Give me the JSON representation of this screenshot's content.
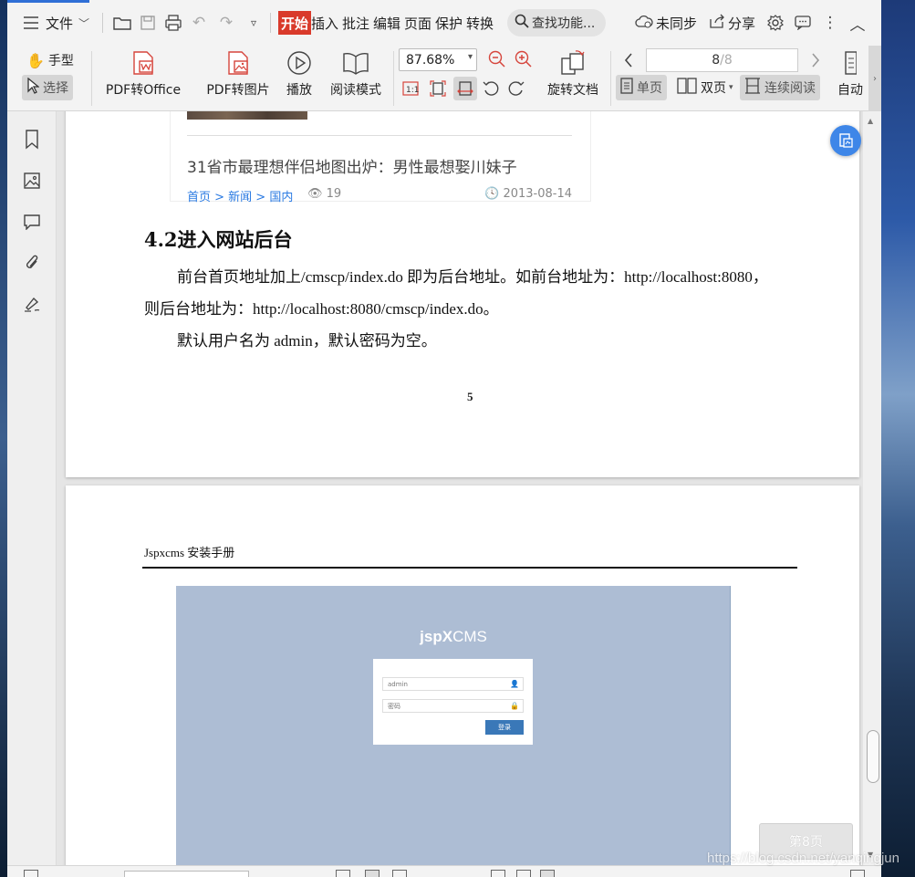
{
  "menubar": {
    "file_label": "文件",
    "tabs": [
      {
        "label": "开始",
        "active": true
      },
      {
        "label": "插入"
      },
      {
        "label": "批注"
      },
      {
        "label": "编辑"
      },
      {
        "label": "页面"
      },
      {
        "label": "保护"
      },
      {
        "label": "转换"
      }
    ],
    "search_placeholder": "查找功能...",
    "sync_label": "未同步",
    "share_label": "分享"
  },
  "ribbon": {
    "hand_label": "手型",
    "select_label": "选择",
    "pdf_to_office": "PDF转Office",
    "pdf_to_image": "PDF转图片",
    "play": "播放",
    "read_mode": "阅读模式",
    "zoom": "87.68%",
    "rotate_doc": "旋转文档",
    "page_current": "8",
    "page_total": "/8",
    "single_page": "单页",
    "double_page": "双页",
    "continuous": "连续阅读",
    "auto": "自动"
  },
  "doc": {
    "news": {
      "title": "31省市最理想伴侣地图出炉：男性最想娶川妹子",
      "crumb": "首页 > 新闻 > 国内",
      "views": "19",
      "date": "2013-08-14"
    },
    "heading": "4.2进入网站后台",
    "para1a": "前台首页地址加上/cmscp/index.do  即为后台地址。如前台地址为：http://localhost:8080，",
    "para1b": "则后台地址为：http://localhost:8080/cmscp/index.do。",
    "para2": "默认用户名为  admin，默认密码为空。",
    "page_number": "5",
    "page2_header": "Jspxcms 安装手册",
    "login": {
      "brand_a": "jsp",
      "brand_b": "X",
      "brand_c": "CMS",
      "username": "admin",
      "password_placeholder": "密码",
      "button": "登录"
    }
  },
  "page_indicator": "第8页",
  "watermark": "https://blog.csdn.net/yanqingjun",
  "colors": {
    "accent": "#d93a2b",
    "float_button": "#3e86e8",
    "link": "#2a7ae2"
  }
}
